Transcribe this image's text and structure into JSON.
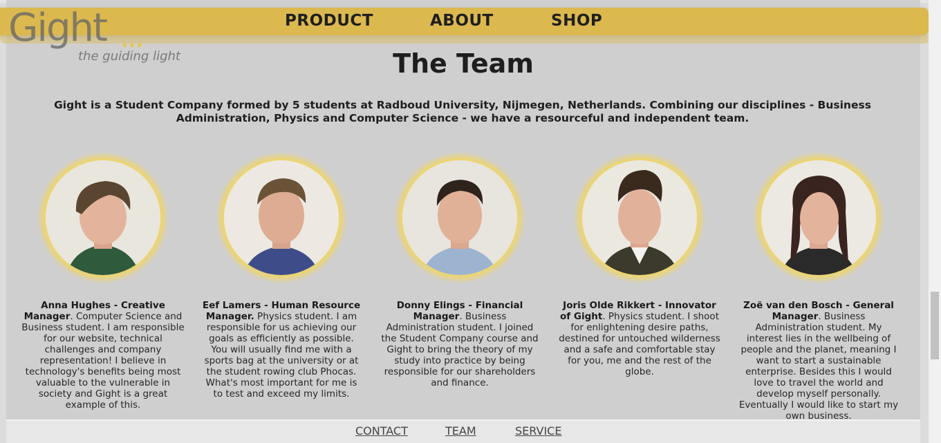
{
  "logo": {
    "word": "Gight",
    "dots": "...",
    "tagline": "the guiding light"
  },
  "nav": {
    "items": [
      "PRODUCT",
      "ABOUT",
      "SHOP"
    ]
  },
  "page": {
    "title": "The Team",
    "intro": "Gight is a Student Company formed by 5 students at Radboud University, Nijmegen, Netherlands. Combining our disciplines - Business Administration, Physics and Computer Science - we have a resourceful and independent team."
  },
  "members": [
    {
      "name": "Anna Hughes - Creative Manager",
      "sep": ".",
      "bio": " Computer Science and Business student. I am responsible for our website, technical challenges and company representation! I believe in technology's benefits being most valuable to the vulnerable in society and Gight is a great example of this."
    },
    {
      "name": "Eef Lamers - Human Resource Manager.",
      "sep": "",
      "bio": " Physics student. I am responsible for us achieving our goals as efficiently as possible. You will usually find me with a sports bag at the university or at the student rowing club Phocas. What's most important for me is to test and exceed my limits."
    },
    {
      "name": "Donny Elings - Financial Manager",
      "sep": ".",
      "bio": " Business Administration student. I joined the Student Company course and Gight to bring the theory of my study into practice by being responsible for our shareholders and finance."
    },
    {
      "name": "Joris Olde Rikkert - Innovator of Gight",
      "sep": ".",
      "bio": " Physics student. I shoot for enlightening desire paths, destined for untouched wilderness and a safe and comfortable stay for you, me and the rest of the globe."
    },
    {
      "name": "Zoë van den Bosch - General Manager",
      "sep": ".",
      "bio": " Business Administration student. My interest lies in the wellbeing of people and the planet, meaning I want to start a sustainable enterprise. Besides this I would love to travel the world and develop myself personally. Eventually I would like to start my own business."
    }
  ],
  "footer": {
    "links": [
      "CONTACT",
      "TEAM",
      "SERVICE"
    ]
  },
  "colors": {
    "accent": "#dbb94f",
    "ring": "#f0ca2a",
    "background": "#cfcfcf"
  }
}
